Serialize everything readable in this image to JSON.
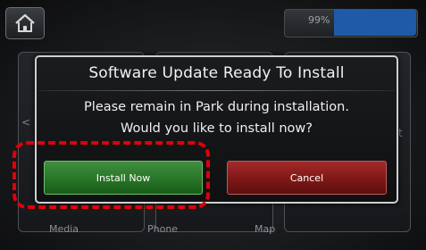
{
  "top_bar": {
    "home_icon": "home-icon",
    "status_text": "99%"
  },
  "dialog": {
    "title": "Software Update Ready To Install",
    "message_line1": "Please remain in Park during installation.",
    "message_line2": "Would you like to install now?",
    "install_label": "Install Now",
    "cancel_label": "Cancel"
  },
  "background_tiles": {
    "labels": [
      "Media",
      "Phone",
      "Map"
    ]
  },
  "side_glyphs": {
    "left": "<",
    "right": "t"
  },
  "colors": {
    "install_button": "#2c7a2c",
    "cancel_button": "#861a1a",
    "highlight": "#e0000a",
    "status_accent": "#1e5aa8"
  }
}
